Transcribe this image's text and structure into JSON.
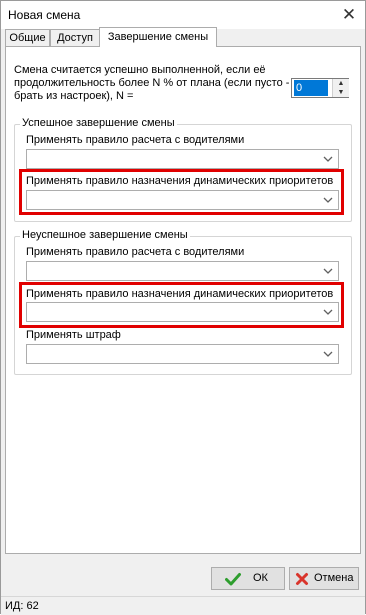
{
  "window": {
    "title": "Новая смена",
    "close_glyph": "✕"
  },
  "tabs": [
    {
      "label": "Общие",
      "active": false
    },
    {
      "label": "Доступ",
      "active": false
    },
    {
      "label": "Завершение смены",
      "active": true
    }
  ],
  "intro": {
    "text": "Смена считается успешно выполненной, если её продолжительность более N % от плана (если пусто - брать из настроек), N =",
    "n_value": "0"
  },
  "success_group": {
    "title": "Успешное завершение смены",
    "fields": [
      {
        "label": "Применять правило расчета с водителями",
        "value": ""
      },
      {
        "label": "Применять правило назначения динамических приоритетов",
        "value": ""
      }
    ]
  },
  "failure_group": {
    "title": "Неуспешное завершение смены",
    "fields": [
      {
        "label": "Применять правило расчета с водителями",
        "value": ""
      },
      {
        "label": "Применять правило назначения динамических приоритетов",
        "value": ""
      },
      {
        "label": "Применять штраф",
        "value": ""
      }
    ]
  },
  "buttons": {
    "ok": "ОК",
    "cancel": "Отмена"
  },
  "status": {
    "text": "ИД: 62"
  },
  "colors": {
    "highlight": "#e10000",
    "selection": "#0078d7",
    "ok_icon": "#2e9e2e",
    "cancel_icon": "#d9342b"
  }
}
